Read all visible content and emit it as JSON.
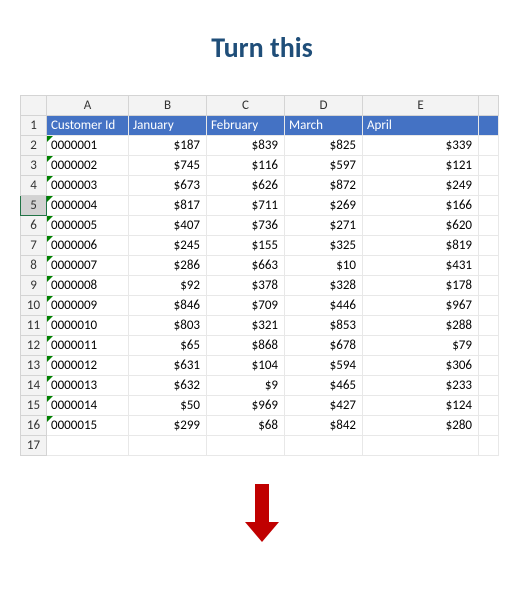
{
  "title": "Turn this",
  "columns": [
    "A",
    "B",
    "C",
    "D",
    "E"
  ],
  "headers": {
    "a": "Customer Id",
    "b": "January",
    "c": "February",
    "d": "March",
    "e": "April"
  },
  "selected_row": 5,
  "rows": [
    {
      "n": 2,
      "id": "0000001",
      "jan": "$187",
      "feb": "$839",
      "mar": "$825",
      "apr": "$339"
    },
    {
      "n": 3,
      "id": "0000002",
      "jan": "$745",
      "feb": "$116",
      "mar": "$597",
      "apr": "$121"
    },
    {
      "n": 4,
      "id": "0000003",
      "jan": "$673",
      "feb": "$626",
      "mar": "$872",
      "apr": "$249"
    },
    {
      "n": 5,
      "id": "0000004",
      "jan": "$817",
      "feb": "$711",
      "mar": "$269",
      "apr": "$166"
    },
    {
      "n": 6,
      "id": "0000005",
      "jan": "$407",
      "feb": "$736",
      "mar": "$271",
      "apr": "$620"
    },
    {
      "n": 7,
      "id": "0000006",
      "jan": "$245",
      "feb": "$155",
      "mar": "$325",
      "apr": "$819"
    },
    {
      "n": 8,
      "id": "0000007",
      "jan": "$286",
      "feb": "$663",
      "mar": "$10",
      "apr": "$431"
    },
    {
      "n": 9,
      "id": "0000008",
      "jan": "$92",
      "feb": "$378",
      "mar": "$328",
      "apr": "$178"
    },
    {
      "n": 10,
      "id": "0000009",
      "jan": "$846",
      "feb": "$709",
      "mar": "$446",
      "apr": "$967"
    },
    {
      "n": 11,
      "id": "0000010",
      "jan": "$803",
      "feb": "$321",
      "mar": "$853",
      "apr": "$288"
    },
    {
      "n": 12,
      "id": "0000011",
      "jan": "$65",
      "feb": "$868",
      "mar": "$678",
      "apr": "$79"
    },
    {
      "n": 13,
      "id": "0000012",
      "jan": "$631",
      "feb": "$104",
      "mar": "$594",
      "apr": "$306"
    },
    {
      "n": 14,
      "id": "0000013",
      "jan": "$632",
      "feb": "$9",
      "mar": "$465",
      "apr": "$233"
    },
    {
      "n": 15,
      "id": "0000014",
      "jan": "$50",
      "feb": "$969",
      "mar": "$427",
      "apr": "$124"
    },
    {
      "n": 16,
      "id": "0000015",
      "jan": "$299",
      "feb": "$68",
      "mar": "$842",
      "apr": "$280"
    }
  ],
  "empty_row": 17
}
